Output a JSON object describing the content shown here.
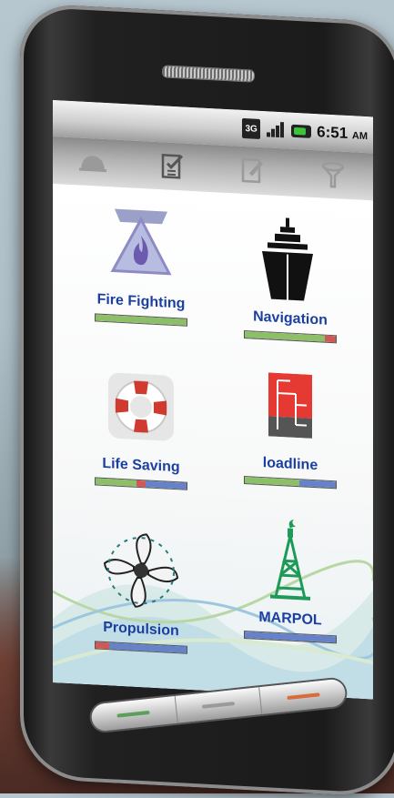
{
  "statusbar": {
    "network_label": "3G",
    "time": "6:51",
    "ampm": "AM",
    "icons": [
      "network-3g-icon",
      "signal-icon",
      "battery-charging-icon"
    ]
  },
  "toolbar": {
    "items": [
      {
        "icon": "hardhat-icon",
        "active": false
      },
      {
        "icon": "checklist-icon",
        "active": true
      },
      {
        "icon": "edit-note-icon",
        "active": false
      },
      {
        "icon": "filter-icon",
        "active": false
      }
    ]
  },
  "modules": [
    {
      "label": "Fire Fighting",
      "icon": "fire-triangle-icon",
      "progress": {
        "green": 1.0,
        "red": 0.0,
        "blue": 0.0
      }
    },
    {
      "label": "Navigation",
      "icon": "ship-icon",
      "progress": {
        "green": 0.88,
        "red": 0.12,
        "blue": 0.0
      }
    },
    {
      "label": "Life  Saving",
      "icon": "lifebuoy-icon",
      "progress": {
        "green": 0.45,
        "red": 0.1,
        "blue": 0.45
      }
    },
    {
      "label": "loadline",
      "icon": "loadline-mark-icon",
      "progress": {
        "green": 0.6,
        "red": 0.0,
        "blue": 0.4
      }
    },
    {
      "label": "Propulsion",
      "icon": "propeller-icon",
      "progress": {
        "green": 0.0,
        "red": 0.15,
        "blue": 0.85
      }
    },
    {
      "label": "MARPOL",
      "icon": "oil-rig-icon",
      "progress": {
        "green": 0.0,
        "red": 0.0,
        "blue": 1.0
      }
    }
  ],
  "softkeys": [
    {
      "icon": "back-key-icon",
      "color": "#5aa05a"
    },
    {
      "icon": "home-key-icon",
      "color": "#9a9a9a"
    },
    {
      "icon": "menu-key-icon",
      "color": "#d96a3a"
    }
  ]
}
